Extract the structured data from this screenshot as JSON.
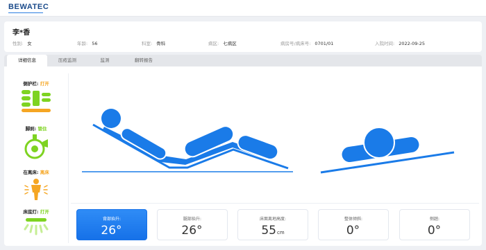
{
  "brand": "BEWATEC",
  "patient": {
    "name": "李*香",
    "fields": [
      {
        "label": "性别:",
        "value": "女"
      },
      {
        "label": "年龄:",
        "value": "56"
      },
      {
        "label": "科室:",
        "value": "骨科"
      },
      {
        "label": "病区:",
        "value": "七病区"
      },
      {
        "label": "病房号/病床号:",
        "value": "0701/01"
      },
      {
        "label": "入院时间:",
        "value": "2022-09-25"
      }
    ]
  },
  "tabs": [
    "详细信息",
    "压疮监测",
    "监测",
    "翻转报告"
  ],
  "status": [
    {
      "label": "侧护栏:",
      "value": "打开",
      "color": "#f5a623",
      "icon": "side-rail-icon"
    },
    {
      "label": "脚刹:",
      "value": "锁住",
      "color": "#7ed321",
      "icon": "brake-icon"
    },
    {
      "label": "在离床:",
      "value": "离床",
      "color": "#f5a623",
      "icon": "person-out-of-bed-icon"
    },
    {
      "label": "床底灯:",
      "value": "打开",
      "color": "#7ed321",
      "icon": "bed-light-icon"
    }
  ],
  "metrics": [
    {
      "label": "背部抬升:",
      "value": "26°",
      "unit": ""
    },
    {
      "label": "腿部抬升:",
      "value": "26°",
      "unit": ""
    },
    {
      "label": "床面离地高度:",
      "value": "55",
      "unit": "cm"
    },
    {
      "label": "整体倾斜:",
      "value": "0°",
      "unit": ""
    },
    {
      "label": "侧趟:",
      "value": "0°",
      "unit": ""
    }
  ],
  "colors": {
    "accent": "#1671e8",
    "orange": "#f5a623",
    "green": "#7ed321"
  }
}
